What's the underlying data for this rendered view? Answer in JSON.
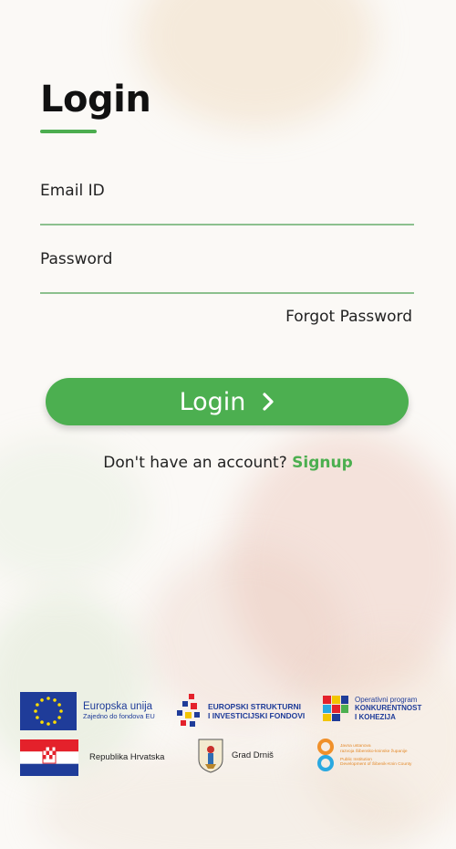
{
  "login": {
    "title": "Login",
    "email_label": "Email ID",
    "email_value": "",
    "password_label": "Password",
    "password_value": "",
    "forgot_password": "Forgot Password",
    "login_button": "Login",
    "no_account_text": "Don't have an account?",
    "signup_link": "Signup"
  },
  "logos": {
    "eu_title": "Europska unija",
    "eu_subtitle": "Zajedno do fondova EU",
    "esi_line1": "EUROPSKI STRUKTURNI",
    "esi_line2": "I INVESTICIJSKI FONDOVI",
    "op_line1": "Operativni program",
    "op_line2": "KONKURENTNOST",
    "op_line3": "I KOHEZIJA",
    "croatia": "Republika Hrvatska",
    "drnis": "Grad Drniš",
    "sibenik_line1": "Javna ustanova",
    "sibenik_line2": "razvoja Šibensko-kninske županije",
    "sibenik_line3": "Public Institution",
    "sibenik_line4": "Development of Šibenik-Knin County"
  },
  "colors": {
    "accent": "#4caf50",
    "underline": "#8cc08e",
    "eu_blue": "#1f3c99"
  },
  "icons": {
    "login_arrow": "chevron-right-icon"
  }
}
